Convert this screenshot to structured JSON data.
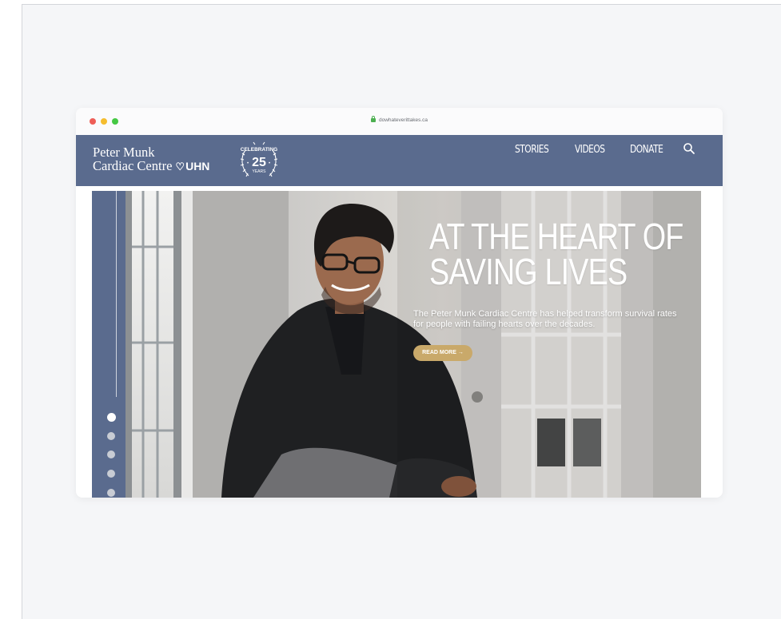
{
  "browser": {
    "url": "dowhateverittakes.ca"
  },
  "header": {
    "logo_line1": "Peter Munk",
    "logo_line2": "Cardiac Centre",
    "logo_uhn": "UHN",
    "badge_top": "CELEBRATING",
    "badge_number": "25",
    "badge_bottom": "YEARS",
    "nav": [
      "STORIES",
      "VIDEOS",
      "DONATE"
    ]
  },
  "hero": {
    "headline_line1": "AT THE HEART OF",
    "headline_line2": "SAVING LIVES",
    "subtext": "The Peter Munk Cardiac Centre has helped transform survival rates for people with failing hearts over the decades.",
    "cta_label": "READ MORE →",
    "slides_count": 5,
    "active_slide": 1
  },
  "colors": {
    "brand_navy": "#5a6b8e",
    "cta_gold": "#c9a96a",
    "page_bg": "#f5f6f8"
  },
  "icons": [
    "lock-icon",
    "search-icon",
    "laurel-badge-icon",
    "heart-uhn-icon"
  ]
}
